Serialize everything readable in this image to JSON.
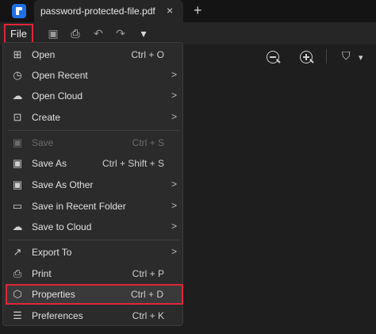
{
  "tab": {
    "title": "password-protected-file.pdf",
    "close": "×",
    "new_tab": "+"
  },
  "toolbar": {
    "file_label": "File"
  },
  "menu": {
    "items": [
      {
        "label": "Open",
        "shortcut": "Ctrl + O",
        "submenu": false,
        "icon": "open-icon",
        "glyph": "⊞"
      },
      {
        "label": "Open Recent",
        "shortcut": "",
        "submenu": true,
        "icon": "clock-icon",
        "glyph": "◷"
      },
      {
        "label": "Open Cloud",
        "shortcut": "",
        "submenu": true,
        "icon": "cloud-icon",
        "glyph": "☁"
      },
      {
        "label": "Create",
        "shortcut": "",
        "submenu": true,
        "icon": "create-icon",
        "glyph": "⊡"
      },
      {
        "label": "Save",
        "shortcut": "Ctrl + S",
        "submenu": false,
        "icon": "save-icon",
        "glyph": "▣",
        "disabled": true
      },
      {
        "label": "Save As",
        "shortcut": "Ctrl + Shift + S",
        "submenu": false,
        "icon": "save-as-icon",
        "glyph": "▣"
      },
      {
        "label": "Save As Other",
        "shortcut": "",
        "submenu": true,
        "icon": "save-as-other-icon",
        "glyph": "▣"
      },
      {
        "label": "Save in Recent Folder",
        "shortcut": "",
        "submenu": true,
        "icon": "folder-icon",
        "glyph": "▭"
      },
      {
        "label": "Save to Cloud",
        "shortcut": "",
        "submenu": true,
        "icon": "cloud-upload-icon",
        "glyph": "☁"
      },
      {
        "label": "Export To",
        "shortcut": "",
        "submenu": true,
        "icon": "export-icon",
        "glyph": "↗"
      },
      {
        "label": "Print",
        "shortcut": "Ctrl + P",
        "submenu": false,
        "icon": "print-icon",
        "glyph": "⎙"
      },
      {
        "label": "Properties",
        "shortcut": "Ctrl + D",
        "submenu": false,
        "icon": "properties-icon",
        "glyph": "⬡",
        "highlighted": true
      },
      {
        "label": "Preferences",
        "shortcut": "Ctrl + K",
        "submenu": false,
        "icon": "preferences-icon",
        "glyph": "☰"
      }
    ],
    "submenu_arrow": ">"
  },
  "colors": {
    "highlight_border": "#e0263a",
    "app_blue": "#1f6fe5"
  }
}
